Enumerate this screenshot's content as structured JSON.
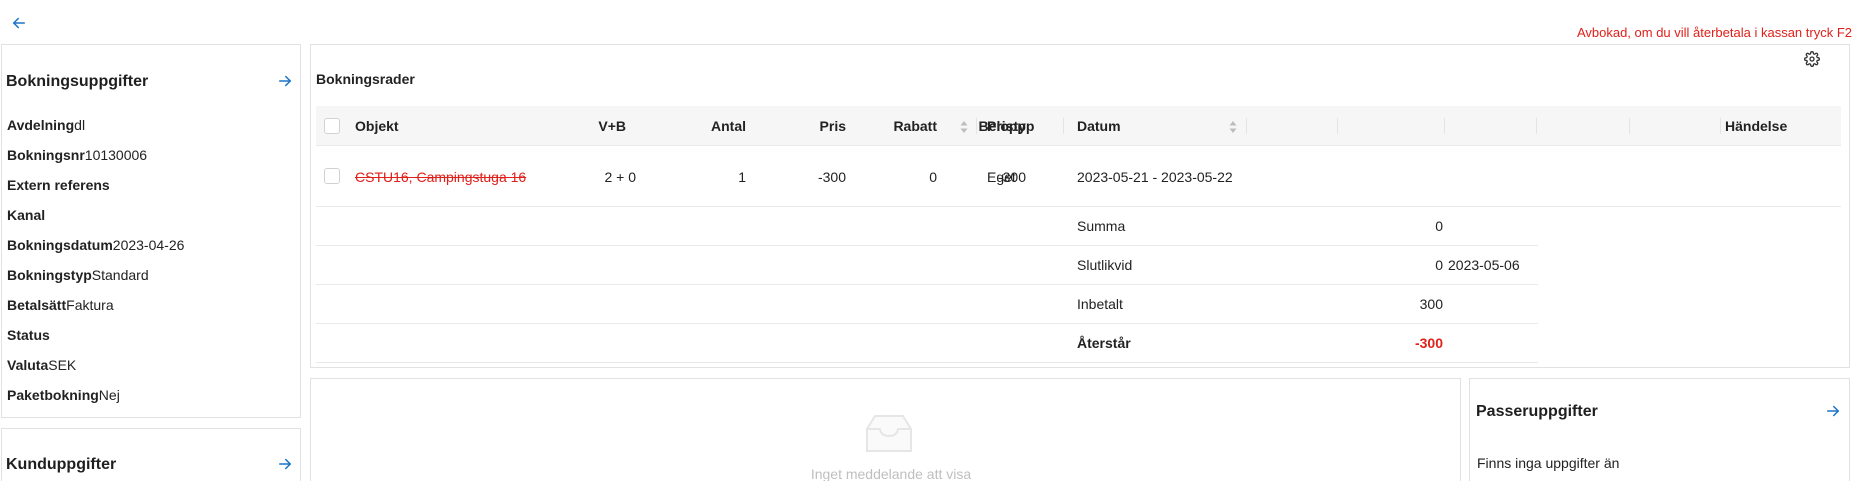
{
  "notice": "Avbokad, om du vill återbetala i kassan tryck F2",
  "booking_info": {
    "title": "Bokningsuppgifter",
    "rows": [
      {
        "key": "Avdelning",
        "value": "dl"
      },
      {
        "key": "Bokningsnr",
        "value": "10130006"
      },
      {
        "key": "Extern referens",
        "value": ""
      },
      {
        "key": "Kanal",
        "value": ""
      },
      {
        "key": "Bokningsdatum",
        "value": "2023-04-26"
      },
      {
        "key": "Bokningstyp",
        "value": "Standard"
      },
      {
        "key": "Betalsätt",
        "value": "Faktura"
      },
      {
        "key": "Status",
        "value": ""
      },
      {
        "key": "Valuta",
        "value": "SEK"
      },
      {
        "key": "Paketbokning",
        "value": "Nej"
      }
    ]
  },
  "customer_info": {
    "title": "Kunduppgifter"
  },
  "booking_rows": {
    "title": "Bokningsrader",
    "columns": {
      "objekt": "Objekt",
      "pristyp": "Pristyp",
      "datum": "Datum",
      "vb": "V+B",
      "antal": "Antal",
      "pris": "Pris",
      "rabatt": "Rabatt",
      "belopp": "Belopp",
      "handelse": "Händelse"
    },
    "rows": [
      {
        "objekt": "CSTU16, Campingstuga 16",
        "pristyp": "Eget",
        "datum": "2023-05-21 - 2023-05-22",
        "vb": "2 + 0",
        "antal": "1",
        "pris": "-300",
        "rabatt": "0",
        "belopp": "-300",
        "handelse": ""
      }
    ],
    "summary": [
      {
        "label": "Summa",
        "value": "0",
        "extra": ""
      },
      {
        "label": "Slutlikvid",
        "value": "0",
        "extra": "2023-05-06"
      },
      {
        "label": "Inbetalt",
        "value": "300",
        "extra": ""
      },
      {
        "label": "Återstår",
        "value": "-300",
        "extra": ""
      }
    ]
  },
  "messages": {
    "empty_text": "Inget meddelande att visa"
  },
  "passenger_info": {
    "title": "Passeruppgifter",
    "empty_text": "Finns inga uppgifter än"
  },
  "colors": {
    "accent": "#1a73c9",
    "danger": "#e0201a",
    "header_bg": "#f6f6f6"
  }
}
